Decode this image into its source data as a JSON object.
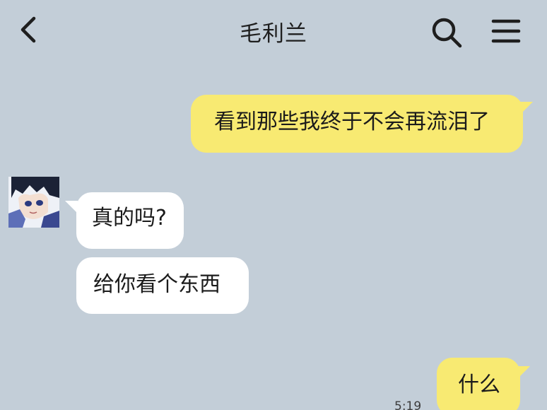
{
  "header": {
    "title": "毛利兰",
    "back_icon": "chevron-left-icon",
    "search_icon": "search-icon",
    "menu_icon": "hamburger-menu-icon"
  },
  "messages": [
    {
      "direction": "outgoing",
      "text": "看到那些我终于不会再流泪了"
    },
    {
      "direction": "incoming",
      "text": "真的吗?"
    },
    {
      "direction": "incoming",
      "text": "给你看个东西"
    },
    {
      "direction": "outgoing",
      "text": "什么"
    }
  ],
  "timestamp": "5:19",
  "colors": {
    "background": "#c3ced8",
    "outgoing_bubble": "#f8ea72",
    "incoming_bubble": "#ffffff"
  },
  "avatar": {
    "icon": "anime-character-avatar"
  }
}
